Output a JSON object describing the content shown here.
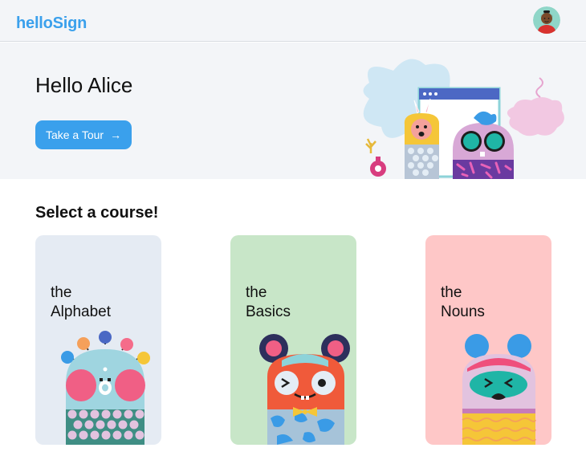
{
  "header": {
    "logo": "helloSign"
  },
  "hero": {
    "greeting": "Hello Alice",
    "tour_button": "Take a Tour"
  },
  "courses_section": {
    "title": "Select a course!"
  },
  "courses": [
    {
      "line1": "the",
      "line2": "Alphabet",
      "color": "#e5ebf3"
    },
    {
      "line1": "the",
      "line2": "Basics",
      "color": "#c8e6c8"
    },
    {
      "line1": "the",
      "line2": "Nouns",
      "color": "#fec7c7"
    }
  ],
  "colors": {
    "accent": "#3aa0ec"
  },
  "icons": {
    "tour_arrow": "arrow-right-icon",
    "avatar": "user-avatar"
  }
}
